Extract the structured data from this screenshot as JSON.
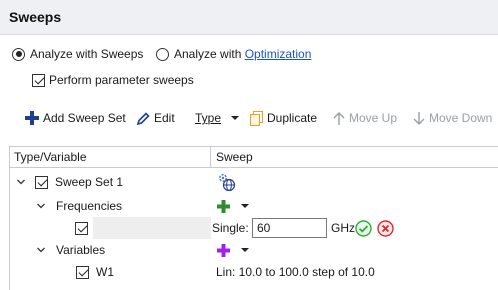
{
  "header": {
    "title": "Sweeps"
  },
  "analyze": {
    "sweeps_label": "Analyze with Sweeps",
    "optimization_prefix": "Analyze with ",
    "optimization_link": "Optimization",
    "sweeps_selected": true
  },
  "perform_param_sweeps": {
    "label": "Perform parameter sweeps",
    "checked": true
  },
  "toolbar": {
    "add_sweep_set": "Add Sweep Set",
    "edit": "Edit",
    "type": "Type",
    "duplicate": "Duplicate",
    "move_up": "Move Up",
    "move_down": "Move Down"
  },
  "grid": {
    "col_type": "Type/Variable",
    "col_sweep": "Sweep",
    "sweep_set": {
      "label": "Sweep Set 1",
      "checked": true
    },
    "frequencies": {
      "label": "Frequencies"
    },
    "freq_entry": {
      "checked": true,
      "mode_label": "Single:",
      "value": "60",
      "unit": "GHz"
    },
    "variables": {
      "label": "Variables"
    },
    "w1": {
      "label": "W1",
      "checked": true,
      "sweep": "Lin: 10.0 to 100.0 step of 10.0"
    }
  },
  "colors": {
    "accent": "#1a56c4",
    "add_green": "#2e8b2e",
    "add_purple": "#a020f0",
    "ok_green": "#2faa3a",
    "cancel_red": "#e0262a"
  }
}
